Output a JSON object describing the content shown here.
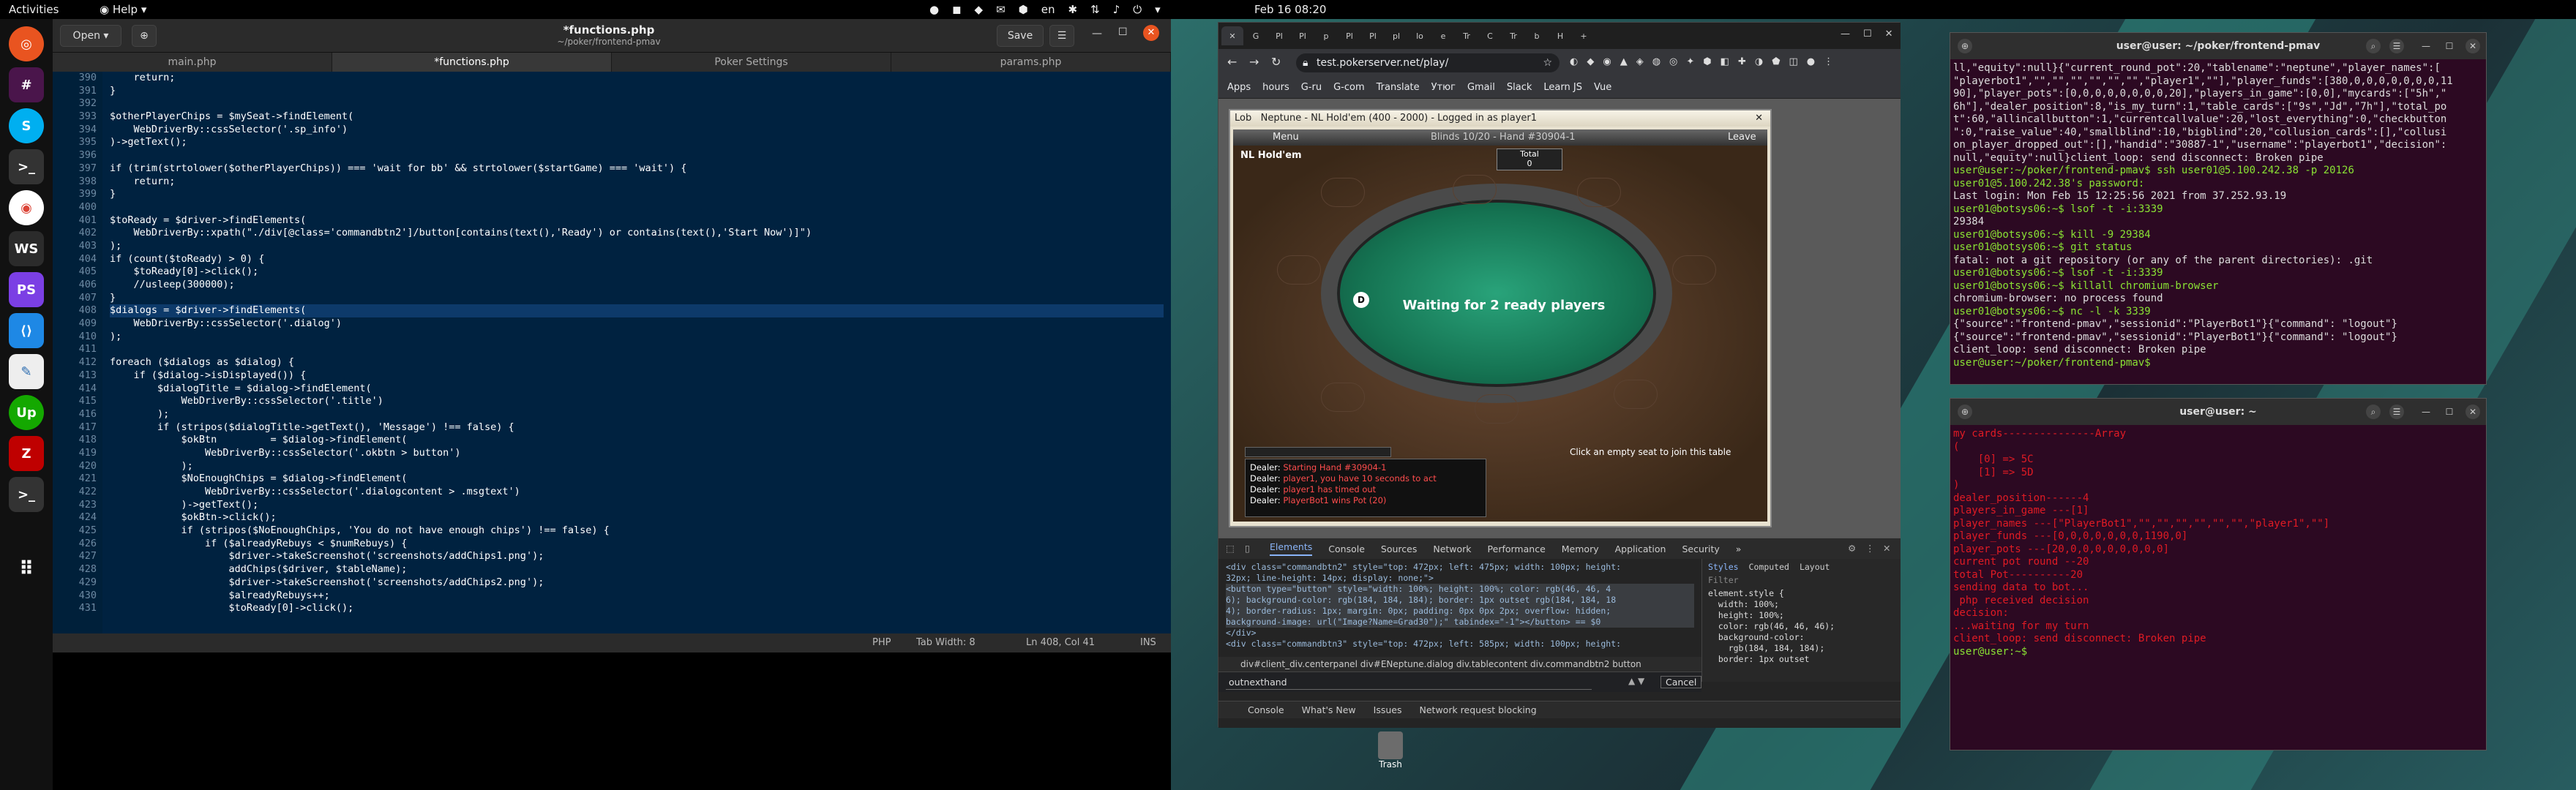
{
  "topbar": {
    "activities": "Activities",
    "help": "Help",
    "clock": "Feb 16  08:20",
    "lang": "en"
  },
  "editor": {
    "open_label": "Open",
    "save_label": "Save",
    "title": "*functions.php",
    "subtitle": "~/poker/frontend-pmav",
    "tabs": [
      "main.php",
      "*functions.php",
      "Poker Settings",
      "params.php"
    ],
    "line_numbers": [
      "390",
      "391",
      "392",
      "393",
      "394",
      "395",
      "396",
      "397",
      "398",
      "399",
      "400",
      "401",
      "402",
      "403",
      "404",
      "405",
      "406",
      "407",
      "408",
      "409",
      "410",
      "411",
      "412",
      "413",
      "414",
      "415",
      "416",
      "417",
      "418",
      "419",
      "420",
      "421",
      "422",
      "423",
      "424",
      "425",
      "426",
      "427",
      "428",
      "429",
      "430",
      "431"
    ],
    "code_lines": [
      "    return;",
      "}",
      "",
      "$otherPlayerChips = $mySeat->findElement(",
      "    WebDriverBy::cssSelector('.sp_info')",
      ")->getText();",
      "",
      "if (trim(strtolower($otherPlayerChips)) === 'wait for bb' && strtolower($startGame) === 'wait') {",
      "    return;",
      "}",
      "",
      "$toReady = $driver->findElements(",
      "    WebDriverBy::xpath(\"./div[@class='commandbtn2']/button[contains(text(),'Ready') or contains(text(),'Start Now')]\")",
      ");",
      "if (count($toReady) > 0) {",
      "    $toReady[0]->click();",
      "    //usleep(300000);",
      "}",
      "$dialogs = $driver->findElements(",
      "    WebDriverBy::cssSelector('.dialog')",
      ");",
      "",
      "foreach ($dialogs as $dialog) {",
      "    if ($dialog->isDisplayed()) {",
      "        $dialogTitle = $dialog->findElement(",
      "            WebDriverBy::cssSelector('.title')",
      "        );",
      "        if (stripos($dialogTitle->getText(), 'Message') !== false) {",
      "            $okBtn         = $dialog->findElement(",
      "                WebDriverBy::cssSelector('.okbtn > button')",
      "            );",
      "            $NoEnoughChips = $dialog->findElement(",
      "                WebDriverBy::cssSelector('.dialogcontent > .msgtext')",
      "            )->getText();",
      "            $okBtn->click();",
      "            if (stripos($NoEnoughChips, 'You do not have enough chips') !== false) {",
      "                if ($alreadyRebuys < $numRebuys) {",
      "                    $driver->takeScreenshot('screenshots/addChips1.png');",
      "                    addChips($driver, $tableName);",
      "                    $driver->takeScreenshot('screenshots/addChips2.png');",
      "                    $alreadyRebuys++;",
      "                    $toReady[0]->click();"
    ],
    "status": {
      "lang": "PHP",
      "tab_width": "Tab Width: 8",
      "position": "Ln 408, Col 41",
      "mode": "INS"
    }
  },
  "browser": {
    "tab_labels": [
      "G",
      "Pl",
      "Pl",
      "p",
      "Pl",
      "Pl",
      "pl",
      "lo",
      "e",
      "Tr",
      "C",
      "Tr",
      "b",
      "H"
    ],
    "url": "test.pokerserver.net/play/",
    "bookmarks": [
      "Apps",
      "hours",
      "G-ru",
      "G-com",
      "Translate",
      "Утюг",
      "Gmail",
      "Slack",
      "Learn JS",
      "Vue"
    ],
    "poker": {
      "window_title": "Neptune - NL Hold'em (400 - 2000) - Logged in as player1",
      "lobby_label": "Lob",
      "menu": "Menu",
      "blinds": "Blinds 10/20 - Hand #30904-1",
      "leave": "Leave",
      "game_name": "NL Hold'em",
      "total_label": "Total",
      "total_value": "0",
      "waiting": "Waiting for 2 ready players",
      "empty_seat": "Click an empty seat to join this table",
      "dealer_marker": "D",
      "log": [
        {
          "who": "Dealer:",
          "msg": "Starting Hand #30904-1"
        },
        {
          "who": "Dealer:",
          "msg": "player1, you have 10 seconds to act"
        },
        {
          "who": "Dealer:",
          "msg": "player1 has timed out"
        },
        {
          "who": "Dealer:",
          "msg": "PlayerBot1 wins Pot (20)"
        }
      ]
    },
    "devtools": {
      "tabs": [
        "Elements",
        "Console",
        "Sources",
        "Network",
        "Performance",
        "Memory",
        "Application",
        "Security"
      ],
      "dom_lines": [
        "<div class=\"commandbtn2\" style=\"top: 472px; left: 475px; width: 100px; height:",
        "32px; line-height: 14px; display: none;\">",
        "<button type=\"button\" style=\"width: 100%; height: 100%; color: rgb(46, 46, 4",
        "6); background-color: rgb(184, 184, 184); border: 1px outset rgb(184, 184, 18",
        "4); border-radius: 1px; margin: 0px; padding: 0px 0px 2px; overflow: hidden;",
        "background-image: url(\"Image?Name=Grad30\");\" tabindex=\"-1\"></button> == $0",
        "</div>",
        "<div class=\"commandbtn3\" style=\"top: 472px; left: 585px; width: 100px; height:"
      ],
      "styles_tabs": [
        "Styles",
        "Computed",
        "Layout"
      ],
      "filter": "Filter",
      "styles_lines": [
        "element.style {",
        "  width: 100%;",
        "  height: 100%;",
        "  color: rgb(46, 46, 46);",
        "  background-color:",
        "    rgb(184, 184, 184);",
        "  border: 1px outset"
      ],
      "crumbs": "div#client_div.centerpanel   div#ENeptune.dialog   div.tablecontent   div.commandbtn2   button",
      "search_value": "outnexthand",
      "cancel": "Cancel",
      "drawer_tabs": [
        "Console",
        "What's New",
        "Issues",
        "Network request blocking"
      ]
    }
  },
  "terminal1": {
    "title": "user@user: ~/poker/frontend-pmav",
    "lines": [
      "ll,\"equity\":null}{\"current_round_pot\":20,\"tablename\":\"neptune\",\"player_names\":[",
      "\"playerbot1\",\"\",\"\",\"\",\"\",\"\",\"\",\"player1\",\"\"],\"player_funds\":[380,0,0,0,0,0,0,0,11",
      "90],\"player_pots\":[0,0,0,0,0,0,0,0,20],\"players_in_game\":[0,0],\"mycards\":[\"5h\",\"",
      "6h\"],\"dealer_position\":8,\"is_my_turn\":1,\"table_cards\":[\"9s\",\"Jd\",\"7h\"],\"total_po",
      "t\":60,\"allincallbutton\":1,\"currentcallvalue\":20,\"lost_everything\":0,\"checkbutton",
      "\":0,\"raise_value\":40,\"smallblind\":10,\"bigblind\":20,\"collusion_cards\":[],\"collusi",
      "on_player_dropped_out\":[],\"handid\":\"30887-1\",\"username\":\"playerbot1\",\"decision\":",
      "null,\"equity\":null}client_loop: send disconnect: Broken pipe",
      "user@user:~/poker/frontend-pmav$ ssh user01@5.100.242.38 -p 20126",
      "user01@5.100.242.38's password:",
      "Last login: Mon Feb 15 12:25:56 2021 from 37.252.93.19",
      "user01@botsys06:~$ lsof -t -i:3339",
      "29384",
      "user01@botsys06:~$ kill -9 29384",
      "user01@botsys06:~$ git status",
      "fatal: not a git repository (or any of the parent directories): .git",
      "user01@botsys06:~$ lsof -t -i:3339",
      "user01@botsys06:~$ killall chromium-browser",
      "chromium-browser: no process found",
      "user01@botsys06:~$ nc -l -k 3339",
      "{\"source\":\"frontend-pmav\",\"sessionid\":\"PlayerBot1\"}{\"command\": \"logout\"}",
      "{\"source\":\"frontend-pmav\",\"sessionid\":\"PlayerBot1\"}{\"command\": \"logout\"}",
      "client_loop: send disconnect: Broken pipe",
      "user@user:~/poker/frontend-pmav$ "
    ]
  },
  "terminal2": {
    "title": "user@user: ~",
    "lines": [
      "my cards---------------Array",
      "(",
      "    [0] => 5C",
      "    [1] => 5D",
      ")",
      "",
      "dealer_position------4",
      "",
      "players_in_game ---[1]",
      "player_names ---[\"PlayerBot1\",\"\",\"\",\"\",\"\",\"\",\"\",\"player1\",\"\"]",
      "player_funds ---[0,0,0,0,0,0,0,1190,0]",
      "player_pots ---[20,0,0,0,0,0,0,0,0]",
      "current pot round --20",
      "total Pot----------20",
      "sending data to bot...",
      "",
      " php received decision",
      "decision:",
      "",
      "...waiting for my turn",
      "client_loop: send disconnect: Broken pipe",
      "user@user:~$ "
    ]
  },
  "desktop": {
    "trash": "Trash"
  },
  "colors": {
    "editor_bg": "#002240",
    "terminal_bg": "#2c0922",
    "table_felt": "#157352",
    "devtools_accent": "#8ab4f8"
  }
}
